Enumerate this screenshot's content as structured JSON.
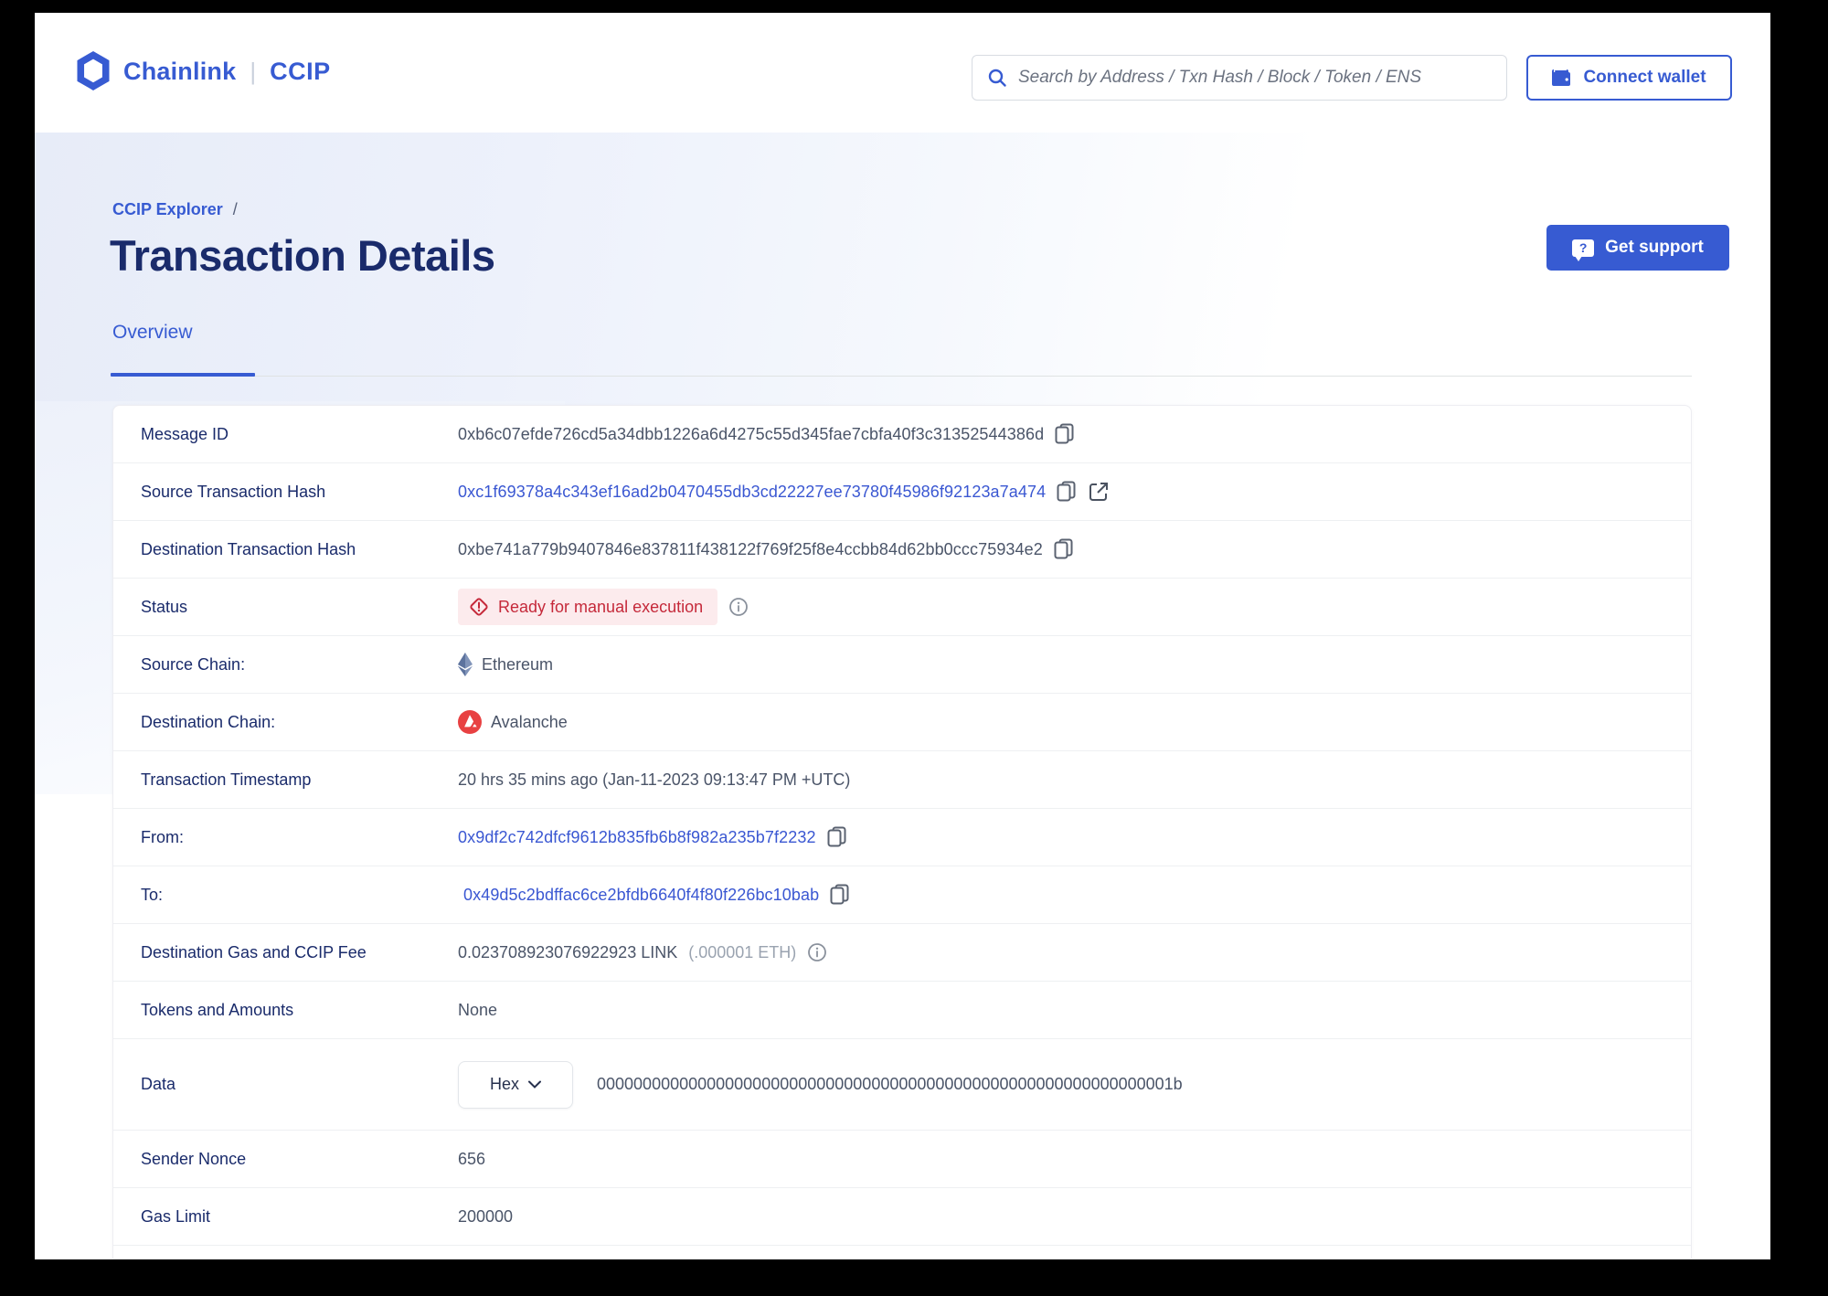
{
  "header": {
    "brand": "Chainlink",
    "separator": "|",
    "product": "CCIP",
    "search_placeholder": "Search by Address / Txn Hash / Block / Token / ENS",
    "connect_wallet_label": "Connect wallet"
  },
  "breadcrumb": {
    "parent": "CCIP Explorer",
    "separator": "/"
  },
  "hero": {
    "title": "Transaction Details",
    "get_support_label": "Get support"
  },
  "tabs": [
    {
      "label": "Overview",
      "active": true
    }
  ],
  "icons": {
    "logo": "chainlink-hexagon",
    "search": "magnifier",
    "wallet": "wallet",
    "support": "question-speech-bubble",
    "copy": "copy-pages",
    "external": "external-link-arrow",
    "info": "info-circle",
    "alert": "alert-diamond",
    "source_chain": "ethereum-diamond",
    "dest_chain": "avalanche-circle",
    "dropdown": "chevron-down"
  },
  "colors": {
    "accent": "#375BD2",
    "title": "#1a2b6b",
    "status_text": "#c5293a",
    "status_bg": "#fcebed",
    "avalanche_red": "#E84142",
    "ethereum_grey": "#687ea3",
    "value_text": "#4a5468"
  },
  "details": {
    "message_id": {
      "label": "Message ID",
      "value": "0xb6c07efde726cd5a34dbb1226a6d4275c55d345fae7cbfa40f3c31352544386d"
    },
    "source_tx": {
      "label": "Source Transaction Hash",
      "value": "0xc1f69378a4c343ef16ad2b0470455db3cd22227ee73780f45986f92123a7a474"
    },
    "dest_tx": {
      "label": "Destination Transaction Hash",
      "value": "0xbe741a779b9407846e837811f438122f769f25f8e4ccbb84d62bb0ccc75934e2"
    },
    "status": {
      "label": "Status",
      "value": "Ready for manual execution"
    },
    "source_chain": {
      "label": "Source Chain:",
      "value": "Ethereum"
    },
    "dest_chain": {
      "label": "Destination Chain:",
      "value": "Avalanche"
    },
    "timestamp": {
      "label": "Transaction Timestamp",
      "value": "20 hrs 35 mins ago (Jan-11-2023 09:13:47 PM +UTC)"
    },
    "from": {
      "label": "From:",
      "value": "0x9df2c742dfcf9612b835fb6b8f982a235b7f2232"
    },
    "to": {
      "label": "To:",
      "value": "0x49d5c2bdffac6ce2bfdb6640f4f80f226bc10bab"
    },
    "fee": {
      "label": "Destination Gas and CCIP Fee",
      "value": "0.023708923076922923 LINK",
      "secondary": "(.000001 ETH)"
    },
    "tokens": {
      "label": "Tokens and Amounts",
      "value": "None"
    },
    "data": {
      "label": "Data",
      "format": "Hex",
      "value": "000000000000000000000000000000000000000000000000000000000000001b"
    },
    "sender_nonce": {
      "label": "Sender Nonce",
      "value": "656"
    },
    "gas_limit": {
      "label": "Gas Limit",
      "value": "200000"
    }
  }
}
